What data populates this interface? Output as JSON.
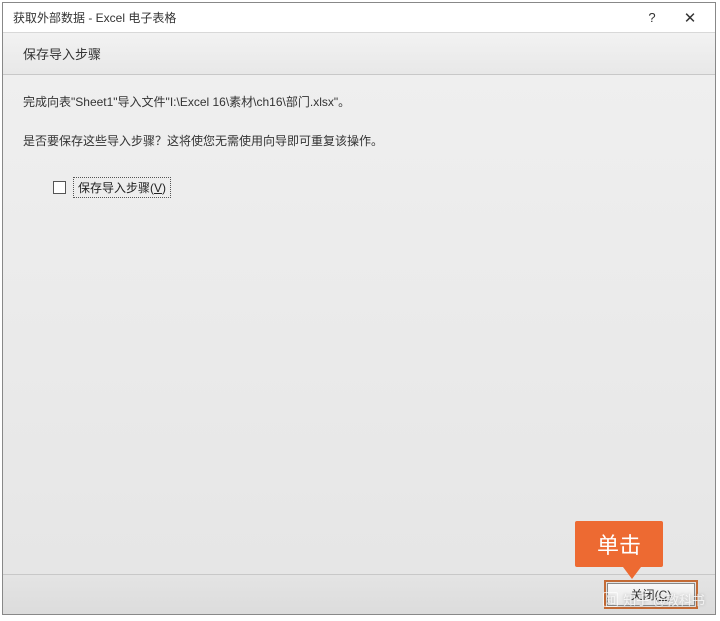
{
  "titlebar": {
    "title": "获取外部数据 - Excel 电子表格",
    "help_label": "?",
    "close_label": "✕"
  },
  "header": {
    "title": "保存导入步骤"
  },
  "content": {
    "line1": "完成向表\"Sheet1\"导入文件\"I:\\Excel 16\\素材\\ch16\\部门.xlsx\"。",
    "line2": "是否要保存这些导入步骤？这将使您无需使用向导即可重复该操作。",
    "checkbox_label_prefix": "保存导入步骤(",
    "checkbox_label_key": "V",
    "checkbox_label_suffix": ")"
  },
  "footer": {
    "close_btn_prefix": "关闭(",
    "close_btn_key": "C",
    "close_btn_suffix": ")"
  },
  "callout": {
    "text": "单击"
  },
  "watermark": {
    "logo": "知",
    "text": "知乎 @教科书"
  }
}
